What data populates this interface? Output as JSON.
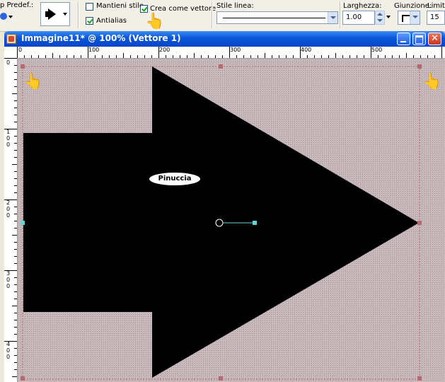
{
  "toolbar": {
    "preset_label": "p Predef.:",
    "keep_style_label": "Mantieni stile",
    "keep_style_checked": false,
    "antialias_label": "Antialias",
    "antialias_checked": true,
    "create_vector_label": "Crea come vettore",
    "create_vector_checked": true,
    "line_style_label": "Stile linea:",
    "width_label": "Larghezza:",
    "width_value": "1.00",
    "join_label": "Giunzione:",
    "limit_label": "Limite",
    "limit_value": "15"
  },
  "window": {
    "title": "Immagine11* @ 100% (Vettore 1)",
    "minimize_icon": "minimize-icon",
    "maximize_icon": "maximize-icon",
    "close_icon": "close-icon"
  },
  "rulers": {
    "top_labels": [
      "0",
      "100",
      "200",
      "300",
      "400",
      "500"
    ],
    "left_labels": [
      "0",
      "1\n0\n0",
      "2\n0\n0",
      "3\n0\n0",
      "4\n0\n0"
    ]
  },
  "canvas": {
    "signature_text": "Pinuccia",
    "arrow_color": "#000000",
    "background_color": "#c8b9bc",
    "pointer_icon": "hand-pointer-icon"
  }
}
